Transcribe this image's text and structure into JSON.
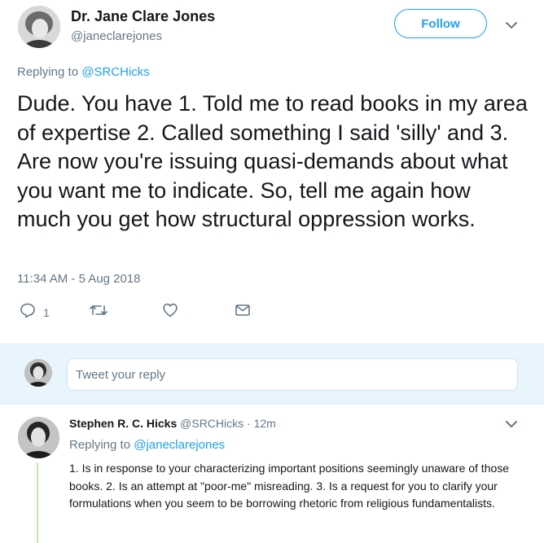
{
  "main_tweet": {
    "author_name": "Dr. Jane Clare Jones",
    "author_handle": "@janeclarejones",
    "follow_label": "Follow",
    "replying_label": "Replying to",
    "replying_to": "@SRCHicks",
    "text": "Dude. You have 1. Told me to read books in my area of expertise 2. Called something I said 'silly' and 3. Are now you're issuing quasi-demands about what you want me to indicate. So, tell me again how much you get how structural oppression works.",
    "timestamp": "11:34 AM - 5 Aug 2018",
    "actions": {
      "reply_count": "1",
      "reply_icon": "reply-icon",
      "retweet_icon": "retweet-icon",
      "like_icon": "heart-icon",
      "dm_icon": "envelope-icon"
    }
  },
  "reply_composer": {
    "placeholder": "Tweet your reply"
  },
  "reply_tweet": {
    "author_name": "Stephen R. C. Hicks",
    "author_handle": "@SRCHicks",
    "separator": "·",
    "time_ago": "12m",
    "replying_label": "Replying to",
    "replying_to": "@janeclarejones",
    "text": "1. Is in response to your characterizing important positions seemingly unaware of those books. 2. Is an attempt at \"poor-me\" misreading. 3. Is a request for you to clarify your formulations when you seem to be borrowing rhetoric from religious fundamentalists."
  },
  "colors": {
    "accent": "#1da1f2",
    "text": "#14171a",
    "muted": "#657786",
    "reply_bar_bg": "#e8f5fd",
    "thread_line": "#c6e7a9"
  }
}
